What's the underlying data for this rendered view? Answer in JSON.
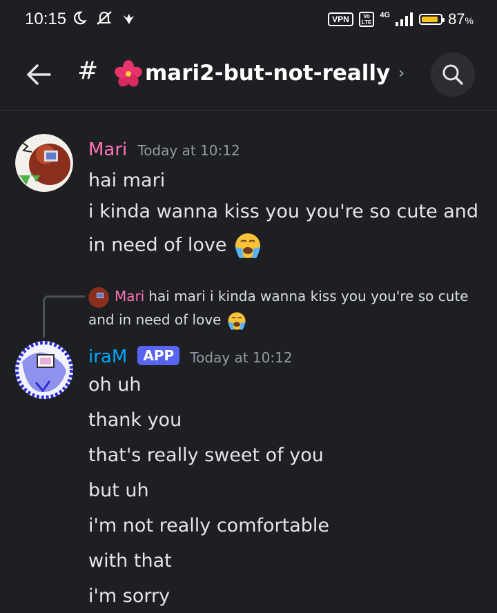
{
  "status_bar": {
    "time": "10:15",
    "vpn": "VPN",
    "volte": "Vo LTE",
    "network": "4G",
    "battery_percent": "87",
    "battery_unit": "%",
    "battery_level": 0.87,
    "battery_color": "#f7c31c"
  },
  "header": {
    "hash": "#",
    "channel_name": "mari2-but-not-really",
    "chevron": "›",
    "back_icon": "arrow-left-icon",
    "search_icon": "search-icon"
  },
  "messages": [
    {
      "author": "Mari",
      "author_color": "#ff73b8",
      "timestamp": "Today at 10:12",
      "lines": [
        "hai mari",
        "i kinda wanna kiss you you're so cute and",
        "in need of love"
      ],
      "trailing_emoji": "loudly-crying-face"
    },
    {
      "reply": {
        "author": "Mari",
        "text_line1": "hai mari i kinda wanna kiss you you're so cute",
        "text_line2": "and in need of love"
      },
      "author": "iraM",
      "author_color": "#00a8fc",
      "badge": "APP",
      "timestamp": "Today at 10:12",
      "lines": [
        "oh uh",
        "thank you",
        "that's really sweet of you",
        "but uh",
        "i'm not really comfortable",
        "with that",
        "i'm sorry"
      ]
    }
  ]
}
